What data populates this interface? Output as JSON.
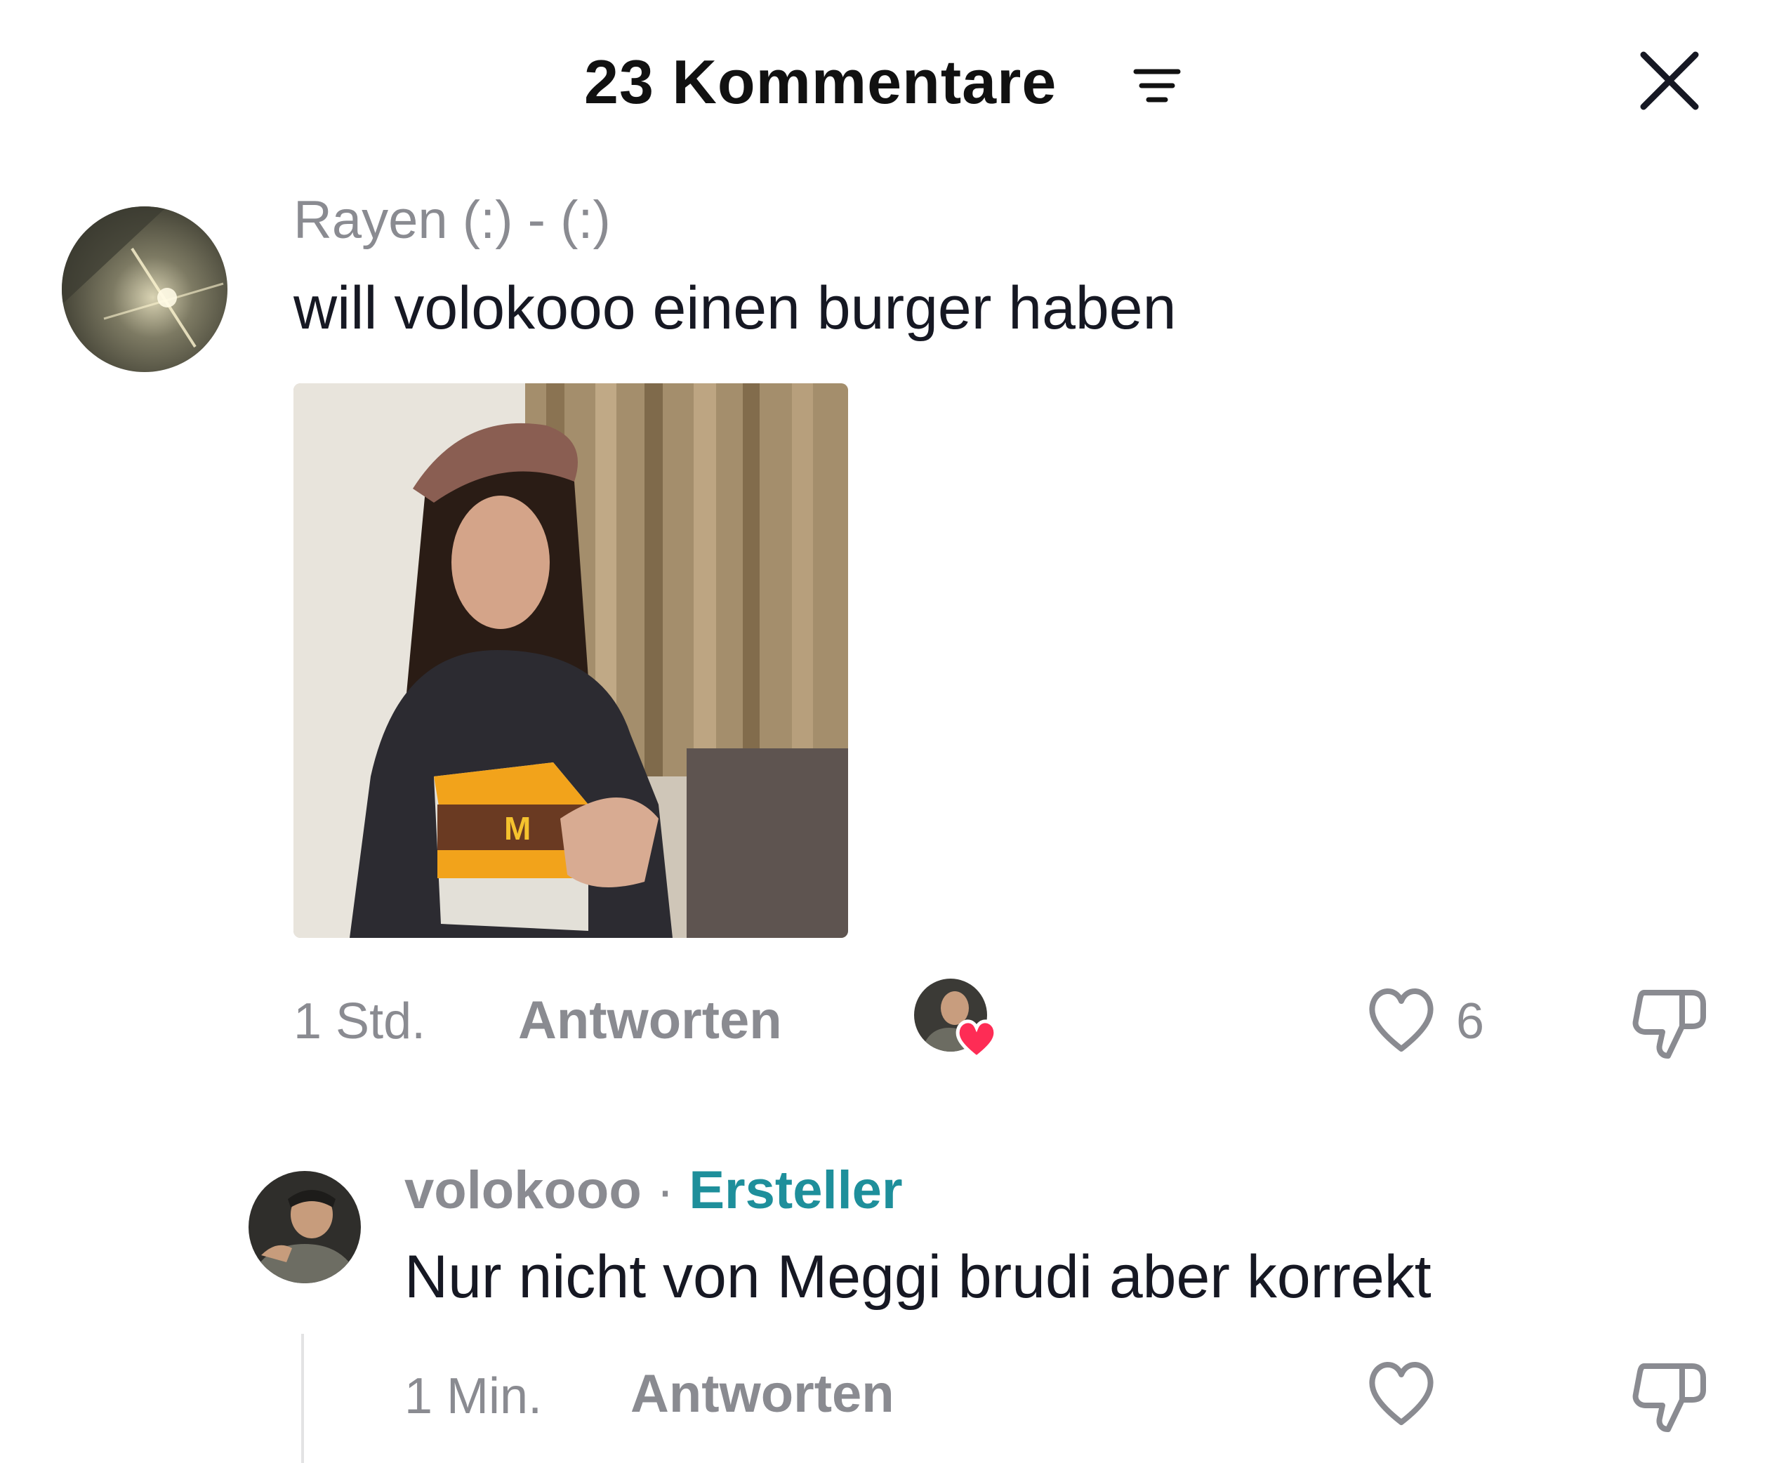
{
  "header": {
    "title": "23 Kommentare"
  },
  "icons": {
    "filter": "filter-icon",
    "close": "close-icon",
    "heart": "heart-outline-icon",
    "dislike": "thumbs-down-icon",
    "creator_liked": "heart-badge-icon"
  },
  "colors": {
    "creator_tag": "#1e8f9b",
    "muted_text": "#8a8b91",
    "heart_badge": "#fe2c55"
  },
  "comments": [
    {
      "username": "Rayen (:) - (:)",
      "text": "will volokooo einen burger haben",
      "image": "photo attachment",
      "time": "1 Std.",
      "reply_label": "Antworten",
      "likes": "6"
    }
  ],
  "replies": [
    {
      "username": "volokooo",
      "separator": "·",
      "badge": "Ersteller",
      "text": "Nur nicht von Meggi brudi aber korrekt",
      "time": "1 Min.",
      "reply_label": "Antworten"
    }
  ]
}
